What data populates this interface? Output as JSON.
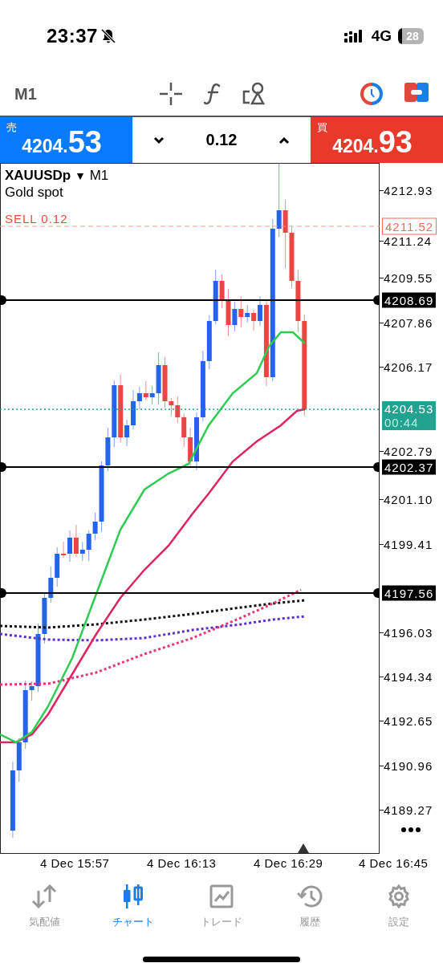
{
  "status_bar": {
    "time": "23:37",
    "network": "4G",
    "battery": "28"
  },
  "toolbar": {
    "timeframe": "M1"
  },
  "trade_panel": {
    "sell": {
      "label": "売",
      "price_main": "4204.",
      "price_big": "53"
    },
    "volume": "0.12",
    "buy": {
      "label": "買",
      "price_main": "4204.",
      "price_big": "93"
    }
  },
  "chart": {
    "symbol": "XAUUSDp",
    "symbol_caret": "▼",
    "timeframe": "M1",
    "description": "Gold spot",
    "order_label": "SELL 0.12",
    "price_ticks": [
      "4212.93",
      "4211.24",
      "4209.55",
      "4207.86",
      "4206.17",
      "4202.79",
      "4201.10",
      "4199.41",
      "4196.03",
      "4194.34",
      "4192.65",
      "4190.96",
      "4189.27"
    ],
    "levels": [
      {
        "kind": "order",
        "price": "4211.52"
      },
      {
        "kind": "line",
        "price": "4208.69"
      },
      {
        "kind": "bid",
        "price": "4204.53",
        "countdown": "00:44"
      },
      {
        "kind": "line",
        "price": "4202.37"
      },
      {
        "kind": "line",
        "price": "4197.56"
      }
    ],
    "time_ticks": [
      "4 Dec 15:57",
      "4 Dec 16:13",
      "4 Dec 16:29",
      "4 Dec 16:45"
    ]
  },
  "tabs": [
    {
      "label": "気配値",
      "kind": "quotes",
      "selected": false
    },
    {
      "label": "チャート",
      "kind": "chart",
      "selected": true
    },
    {
      "label": "トレード",
      "kind": "trade",
      "selected": false
    },
    {
      "label": "履歴",
      "kind": "history",
      "selected": false
    },
    {
      "label": "設定",
      "kind": "settings",
      "selected": false
    }
  ]
}
